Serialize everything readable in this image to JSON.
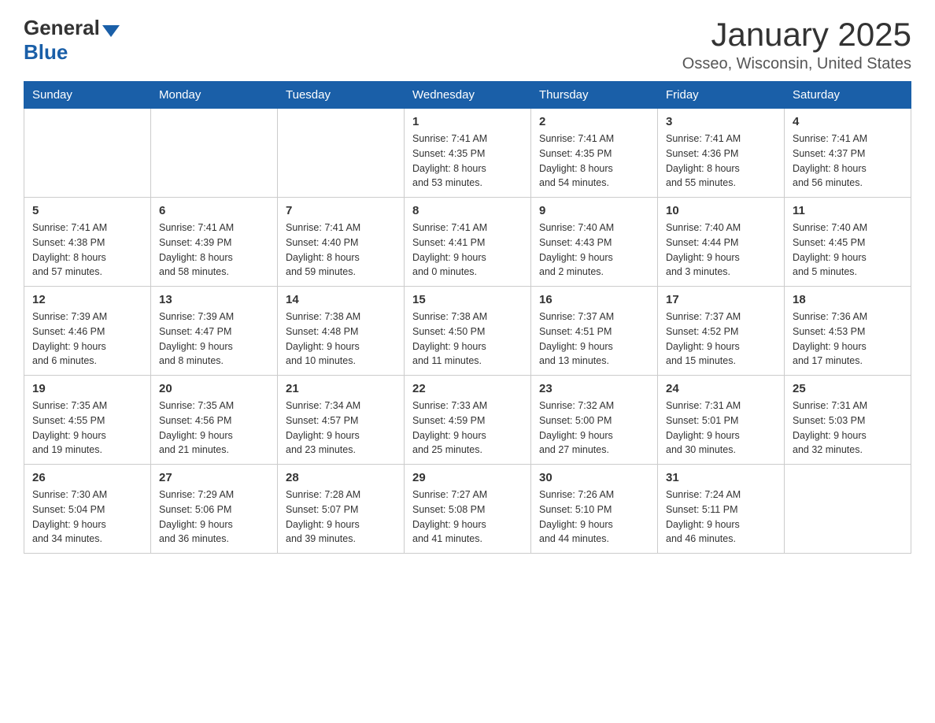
{
  "logo": {
    "general": "General",
    "blue": "Blue"
  },
  "title": "January 2025",
  "subtitle": "Osseo, Wisconsin, United States",
  "days_of_week": [
    "Sunday",
    "Monday",
    "Tuesday",
    "Wednesday",
    "Thursday",
    "Friday",
    "Saturday"
  ],
  "weeks": [
    [
      {
        "day": "",
        "info": ""
      },
      {
        "day": "",
        "info": ""
      },
      {
        "day": "",
        "info": ""
      },
      {
        "day": "1",
        "info": "Sunrise: 7:41 AM\nSunset: 4:35 PM\nDaylight: 8 hours\nand 53 minutes."
      },
      {
        "day": "2",
        "info": "Sunrise: 7:41 AM\nSunset: 4:35 PM\nDaylight: 8 hours\nand 54 minutes."
      },
      {
        "day": "3",
        "info": "Sunrise: 7:41 AM\nSunset: 4:36 PM\nDaylight: 8 hours\nand 55 minutes."
      },
      {
        "day": "4",
        "info": "Sunrise: 7:41 AM\nSunset: 4:37 PM\nDaylight: 8 hours\nand 56 minutes."
      }
    ],
    [
      {
        "day": "5",
        "info": "Sunrise: 7:41 AM\nSunset: 4:38 PM\nDaylight: 8 hours\nand 57 minutes."
      },
      {
        "day": "6",
        "info": "Sunrise: 7:41 AM\nSunset: 4:39 PM\nDaylight: 8 hours\nand 58 minutes."
      },
      {
        "day": "7",
        "info": "Sunrise: 7:41 AM\nSunset: 4:40 PM\nDaylight: 8 hours\nand 59 minutes."
      },
      {
        "day": "8",
        "info": "Sunrise: 7:41 AM\nSunset: 4:41 PM\nDaylight: 9 hours\nand 0 minutes."
      },
      {
        "day": "9",
        "info": "Sunrise: 7:40 AM\nSunset: 4:43 PM\nDaylight: 9 hours\nand 2 minutes."
      },
      {
        "day": "10",
        "info": "Sunrise: 7:40 AM\nSunset: 4:44 PM\nDaylight: 9 hours\nand 3 minutes."
      },
      {
        "day": "11",
        "info": "Sunrise: 7:40 AM\nSunset: 4:45 PM\nDaylight: 9 hours\nand 5 minutes."
      }
    ],
    [
      {
        "day": "12",
        "info": "Sunrise: 7:39 AM\nSunset: 4:46 PM\nDaylight: 9 hours\nand 6 minutes."
      },
      {
        "day": "13",
        "info": "Sunrise: 7:39 AM\nSunset: 4:47 PM\nDaylight: 9 hours\nand 8 minutes."
      },
      {
        "day": "14",
        "info": "Sunrise: 7:38 AM\nSunset: 4:48 PM\nDaylight: 9 hours\nand 10 minutes."
      },
      {
        "day": "15",
        "info": "Sunrise: 7:38 AM\nSunset: 4:50 PM\nDaylight: 9 hours\nand 11 minutes."
      },
      {
        "day": "16",
        "info": "Sunrise: 7:37 AM\nSunset: 4:51 PM\nDaylight: 9 hours\nand 13 minutes."
      },
      {
        "day": "17",
        "info": "Sunrise: 7:37 AM\nSunset: 4:52 PM\nDaylight: 9 hours\nand 15 minutes."
      },
      {
        "day": "18",
        "info": "Sunrise: 7:36 AM\nSunset: 4:53 PM\nDaylight: 9 hours\nand 17 minutes."
      }
    ],
    [
      {
        "day": "19",
        "info": "Sunrise: 7:35 AM\nSunset: 4:55 PM\nDaylight: 9 hours\nand 19 minutes."
      },
      {
        "day": "20",
        "info": "Sunrise: 7:35 AM\nSunset: 4:56 PM\nDaylight: 9 hours\nand 21 minutes."
      },
      {
        "day": "21",
        "info": "Sunrise: 7:34 AM\nSunset: 4:57 PM\nDaylight: 9 hours\nand 23 minutes."
      },
      {
        "day": "22",
        "info": "Sunrise: 7:33 AM\nSunset: 4:59 PM\nDaylight: 9 hours\nand 25 minutes."
      },
      {
        "day": "23",
        "info": "Sunrise: 7:32 AM\nSunset: 5:00 PM\nDaylight: 9 hours\nand 27 minutes."
      },
      {
        "day": "24",
        "info": "Sunrise: 7:31 AM\nSunset: 5:01 PM\nDaylight: 9 hours\nand 30 minutes."
      },
      {
        "day": "25",
        "info": "Sunrise: 7:31 AM\nSunset: 5:03 PM\nDaylight: 9 hours\nand 32 minutes."
      }
    ],
    [
      {
        "day": "26",
        "info": "Sunrise: 7:30 AM\nSunset: 5:04 PM\nDaylight: 9 hours\nand 34 minutes."
      },
      {
        "day": "27",
        "info": "Sunrise: 7:29 AM\nSunset: 5:06 PM\nDaylight: 9 hours\nand 36 minutes."
      },
      {
        "day": "28",
        "info": "Sunrise: 7:28 AM\nSunset: 5:07 PM\nDaylight: 9 hours\nand 39 minutes."
      },
      {
        "day": "29",
        "info": "Sunrise: 7:27 AM\nSunset: 5:08 PM\nDaylight: 9 hours\nand 41 minutes."
      },
      {
        "day": "30",
        "info": "Sunrise: 7:26 AM\nSunset: 5:10 PM\nDaylight: 9 hours\nand 44 minutes."
      },
      {
        "day": "31",
        "info": "Sunrise: 7:24 AM\nSunset: 5:11 PM\nDaylight: 9 hours\nand 46 minutes."
      },
      {
        "day": "",
        "info": ""
      }
    ]
  ]
}
